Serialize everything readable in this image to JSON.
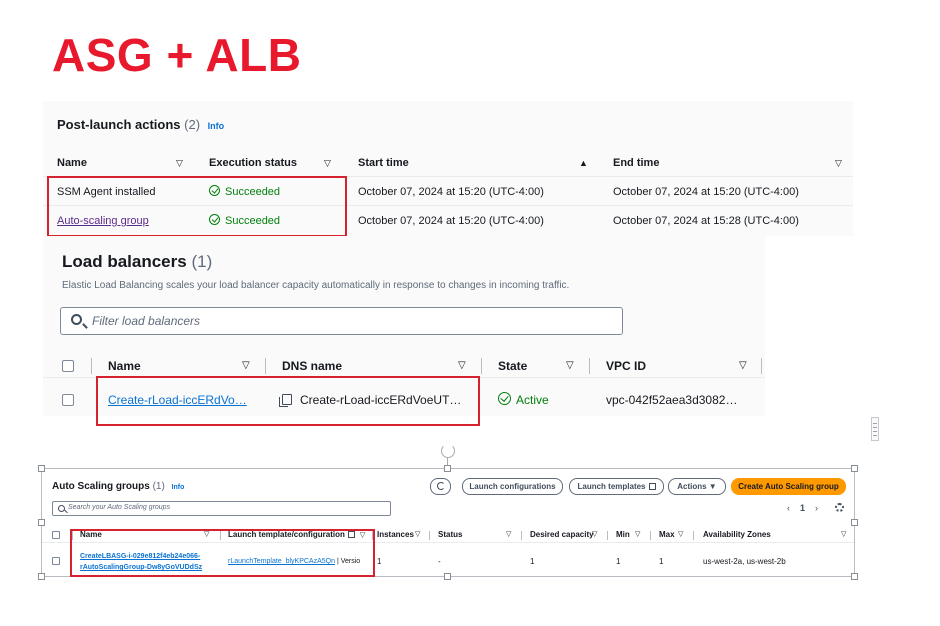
{
  "slide": {
    "title": "ASG + ALB"
  },
  "post_launch": {
    "title": "Post-launch actions",
    "count": "(2)",
    "info": "Info",
    "columns": [
      "Name",
      "Execution status",
      "Start time",
      "End time"
    ],
    "rows": [
      {
        "name": "SSM Agent installed",
        "status": "Succeeded",
        "start": "October 07, 2024 at 15:20 (UTC-4:00)",
        "end": "October 07, 2024 at 15:20 (UTC-4:00)"
      },
      {
        "name": "Auto-scaling group",
        "status": "Succeeded",
        "start": "October 07, 2024 at 15:20 (UTC-4:00)",
        "end": "October 07, 2024 at 15:28 (UTC-4:00)"
      }
    ]
  },
  "load_balancers": {
    "title": "Load balancers",
    "count": "(1)",
    "description": "Elastic Load Balancing scales your load balancer capacity automatically in response to changes in incoming traffic.",
    "search_placeholder": "Filter load balancers",
    "columns": [
      "Name",
      "DNS name",
      "State",
      "VPC ID"
    ],
    "rows": [
      {
        "name": "Create-rLoad-iccERdVo…",
        "dns": "Create-rLoad-iccERdVoeUT…",
        "state": "Active",
        "vpc": "vpc-042f52aea3d3082…"
      }
    ]
  },
  "asg": {
    "title": "Auto Scaling groups",
    "count": "(1)",
    "info": "Info",
    "buttons": {
      "launch_configurations": "Launch configurations",
      "launch_templates": "Launch templates",
      "actions": "Actions ▼",
      "create": "Create Auto Scaling group"
    },
    "search_placeholder": "Search your Auto Scaling groups",
    "pager": {
      "prev": "‹",
      "page": "1",
      "next": "›"
    },
    "columns": [
      "Name",
      "Launch template/configuration",
      "Instances",
      "Status",
      "Desired capacity",
      "Min",
      "Max",
      "Availability Zones"
    ],
    "rows": [
      {
        "name_line1": "CreateLBASG-i-029e812f4eb24e066-",
        "name_line2": "rAutoScalingGroup-Dw8yGoVUDdSz",
        "template": "rLaunchTemplate_blyKPCAzA5Qn",
        "template_suffix": " | Versio",
        "instances": "1",
        "status": "-",
        "desired": "1",
        "min": "1",
        "max": "1",
        "zones": "us-west-2a, us-west-2b"
      }
    ]
  },
  "colors": {
    "title_red": "#e8192c",
    "highlight_red": "#d6222e",
    "success_green": "#037f0c",
    "link_blue": "#0972d3",
    "primary_orange": "#ff9900"
  },
  "icons": [
    "search-icon",
    "success-check-icon",
    "sort-icon",
    "copy-icon",
    "refresh-icon",
    "external-link-icon",
    "settings-gear-icon",
    "rotate-handle-icon"
  ]
}
